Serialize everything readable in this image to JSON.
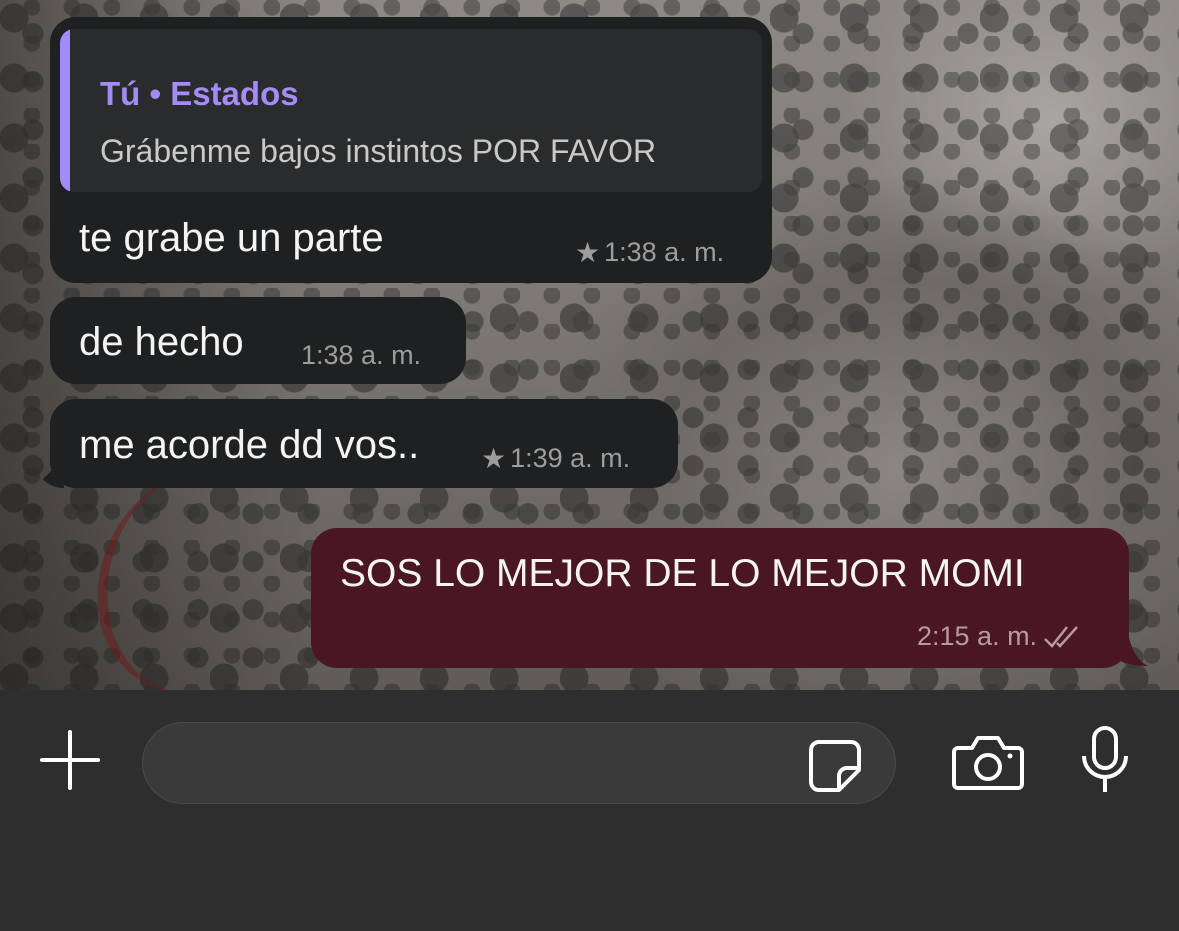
{
  "messages": [
    {
      "quote": {
        "author": "Tú • Estados",
        "text": "Grábenme bajos instintos POR FAVOR"
      },
      "text": "te grabe un parte",
      "time": "1:38 a. m.",
      "starred": true
    },
    {
      "text": "de hecho",
      "time": "1:38 a. m.",
      "starred": false
    },
    {
      "text": "me acorde dd vos..",
      "time": "1:39 a. m.",
      "starred": true
    }
  ],
  "outgoing": {
    "text": "SOS LO MEJOR DE LO MEJOR MOMI",
    "time": "2:15 a. m.",
    "status": "double-check-read"
  },
  "composer": {
    "placeholder": "",
    "icons": [
      "plus-icon",
      "sticker-icon",
      "camera-icon",
      "microphone-icon"
    ]
  },
  "colors": {
    "incoming_bubble": "#1f2021",
    "outgoing_bubble": "#4a1621",
    "quote_accent": "#a58bf5"
  }
}
